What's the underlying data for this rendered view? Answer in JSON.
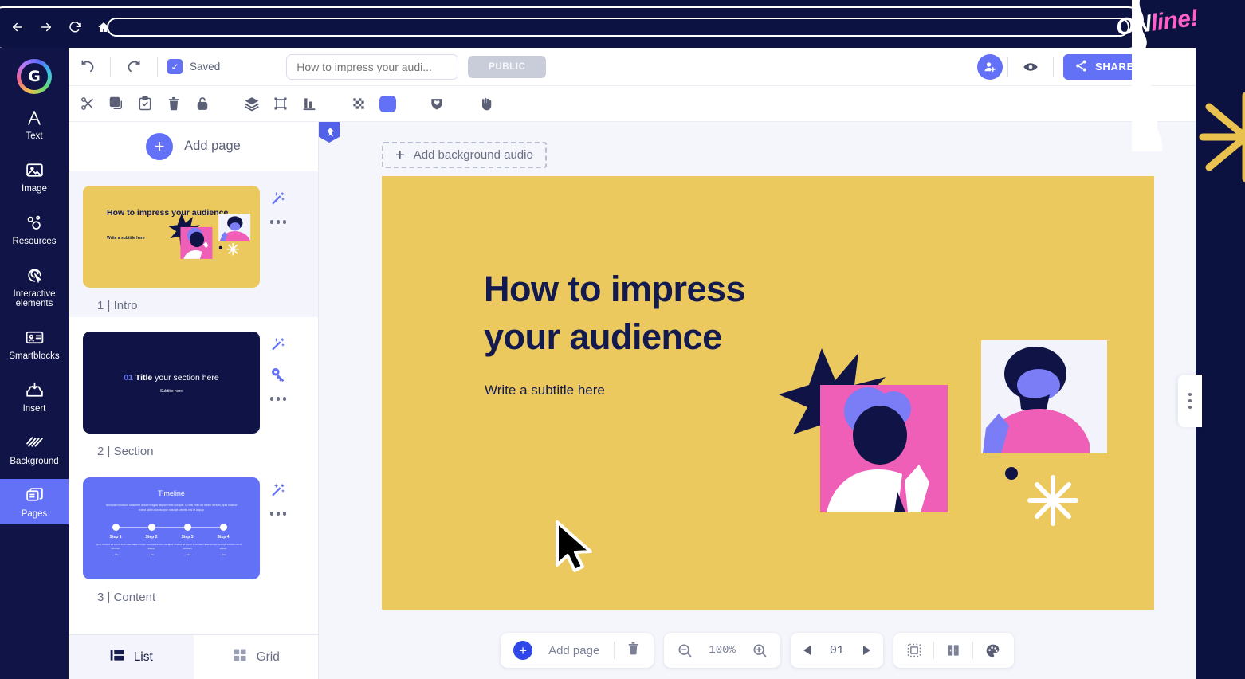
{
  "browser": {
    "back_icon": "back-arrow-icon",
    "forward_icon": "forward-arrow-icon",
    "reload_icon": "reload-icon",
    "home_icon": "home-icon",
    "url_value": ""
  },
  "decor": {
    "badge_on": "ON",
    "badge_line": "line!",
    "starburst_color": "#e9c14e",
    "navy": "#0b1240"
  },
  "rail": {
    "logo_letter": "G",
    "items": [
      {
        "label": "Text",
        "icon": "letter-a-icon",
        "active": false
      },
      {
        "label": "Image",
        "icon": "image-icon",
        "active": false
      },
      {
        "label": "Resources",
        "icon": "resources-bubbles-icon",
        "active": false
      },
      {
        "label": "Interactive elements",
        "icon": "interactive-cursor-icon",
        "active": false
      },
      {
        "label": "Smartblocks",
        "icon": "smartblocks-card-icon",
        "active": false
      },
      {
        "label": "Insert",
        "icon": "insert-upload-icon",
        "active": false
      },
      {
        "label": "Background",
        "icon": "background-stripes-icon",
        "active": false
      },
      {
        "label": "Pages",
        "icon": "pages-stack-icon",
        "active": true
      }
    ]
  },
  "topbar": {
    "undo_icon": "undo-icon",
    "redo_icon": "redo-icon",
    "saved_label": "Saved",
    "saved_check": "✓",
    "title_placeholder": "How to impress your audi...",
    "title_value": "",
    "public_label": "PUBLIC",
    "invite_icon": "add-user-icon",
    "preview_icon": "eye-icon",
    "share_label": "SHARE",
    "share_icon": "share-nodes-icon",
    "accent": "#6371f6"
  },
  "toolbar": {
    "items": [
      {
        "icon": "cut-scissors-icon",
        "name": "cut"
      },
      {
        "icon": "copy-icon",
        "name": "copy"
      },
      {
        "icon": "paste-clipboard-icon",
        "name": "paste"
      },
      {
        "icon": "trash-icon",
        "name": "delete"
      },
      {
        "icon": "unlock-icon",
        "name": "lock"
      },
      {
        "icon": "layers-icon",
        "name": "layers"
      },
      {
        "icon": "crop-frame-icon",
        "name": "frame"
      },
      {
        "icon": "align-bottom-icon",
        "name": "align"
      },
      {
        "icon": "transparency-checker-icon",
        "name": "transparency"
      },
      {
        "icon": "color-swatch-icon",
        "name": "color"
      },
      {
        "icon": "shield-heart-icon",
        "name": "favorite"
      },
      {
        "icon": "hand-grab-icon",
        "name": "hand"
      }
    ],
    "swatch_color": "#6371f6"
  },
  "pages_panel": {
    "add_page_label": "Add page",
    "add_page_icon": "plus-circle-icon",
    "pages": [
      {
        "number": "1",
        "name": "Intro",
        "caption": "1 | Intro",
        "selected": true,
        "theme": "yellow",
        "title": "How to impress your audience",
        "subtitle": "Write a subtitle here",
        "actions": [
          "magic-wand-icon",
          "more-dots-icon"
        ]
      },
      {
        "number": "2",
        "name": "Section",
        "caption": "2 | Section",
        "selected": false,
        "theme": "navy",
        "title_num": "01",
        "title_bold": "Title",
        "title_rest": " your section here",
        "subtitle": "Subtitle here",
        "actions": [
          "magic-wand-icon",
          "key-icon",
          "more-dots-icon"
        ]
      },
      {
        "number": "3",
        "name": "Content",
        "caption": "3 | Content",
        "selected": false,
        "theme": "blue",
        "title": "Timeline",
        "body": "Nunquam tincidunt ut laoreet dolore magna aliquam erat volutpat. Ut wisi enim ad minim veniam, quis nostrud exerci tation ullamcorper suscipit lobortis nisl ut aliquip",
        "steps": [
          {
            "label": "Step 1",
            "body": "Quis nostrud ad exerci tincii ullam la hendrerit",
            "link": "+ Info"
          },
          {
            "label": "Step 2",
            "body": "Ullamcorper suscipit lobortis nisl ut aliquip",
            "link": "+ Info"
          },
          {
            "label": "Step 3",
            "body": "Quis nostrud ad exerci tincii ullam la hendrerit",
            "link": "+ Info"
          },
          {
            "label": "Step 4",
            "body": "Ullamcorper suscipit lobortis nisl ut aliquip",
            "link": "+ Info"
          }
        ],
        "actions": [
          "magic-wand-icon",
          "more-dots-icon"
        ]
      }
    ],
    "footer_tabs": [
      {
        "label": "List",
        "icon": "list-view-icon",
        "active": true
      },
      {
        "label": "Grid",
        "icon": "grid-view-icon",
        "active": false
      }
    ]
  },
  "canvas": {
    "pin_icon": "pin-icon",
    "add_audio_label": "Add background audio",
    "add_audio_plus": "+",
    "slide": {
      "background": "#ecc95e",
      "title_line1": "How to impress",
      "title_line2": "your audience",
      "subtitle": "Write a subtitle here",
      "text_color": "#121a4f",
      "illustration": "two-people-photos-illustration"
    }
  },
  "bottombar": {
    "add_page_label": "Add page",
    "add_page_icon": "plus-circle-icon",
    "delete_icon": "trash-icon",
    "zoom_out_icon": "zoom-out-icon",
    "zoom_level": "100%",
    "zoom_in_icon": "zoom-in-icon",
    "prev_icon": "prev-triangle-icon",
    "page_indicator": "01",
    "next_icon": "next-triangle-icon",
    "fit_icon": "fit-frame-icon",
    "split_icon": "split-view-icon",
    "palette_icon": "palette-icon"
  },
  "drawer": {
    "handle_icon": "more-vertical-dots-icon"
  }
}
